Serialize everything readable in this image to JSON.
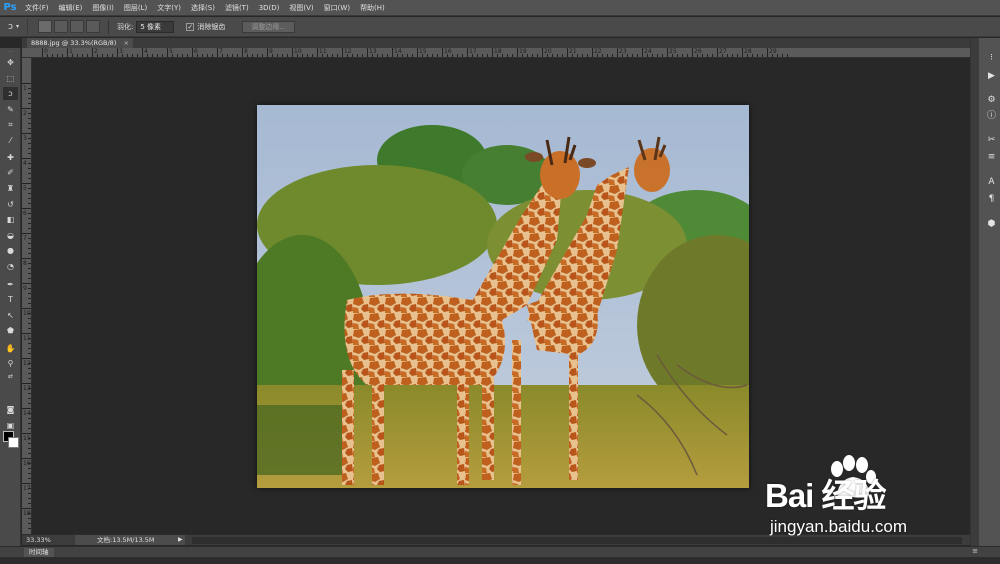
{
  "app": {
    "logo": "Ps"
  },
  "menu": [
    "文件(F)",
    "编辑(E)",
    "图像(I)",
    "图层(L)",
    "文字(Y)",
    "选择(S)",
    "滤镜(T)",
    "3D(D)",
    "视图(V)",
    "窗口(W)",
    "帮助(H)"
  ],
  "options": {
    "tool_icon": "lasso-icon",
    "feather_label": "羽化:",
    "feather_value": "5 像素",
    "antialias_label": "消除锯齿",
    "antialias_checked": true,
    "refine_edge_label": "调整边缘..."
  },
  "document": {
    "tab_title": "8888.jpg @ 33.3%(RGB/8)",
    "close_glyph": "×",
    "image_content": "two-giraffes-photo"
  },
  "ruler_top_labels": [
    "0",
    "1",
    "2",
    "3",
    "4",
    "5",
    "6",
    "7",
    "8",
    "9",
    "10",
    "11",
    "12",
    "13",
    "14",
    "15",
    "16",
    "17",
    "18",
    "19",
    "20",
    "21",
    "22",
    "23",
    "24",
    "25",
    "26",
    "27",
    "28",
    "29"
  ],
  "ruler_left_labels": [
    "1",
    "2",
    "3",
    "4",
    "5",
    "6",
    "7",
    "8",
    "9",
    "10",
    "11",
    "12",
    "13",
    "14",
    "15",
    "16",
    "17",
    "18"
  ],
  "status": {
    "zoom": "33.33%",
    "doc_size": "文档:13.5M/13.5M",
    "arrow_glyph": "▶"
  },
  "timeline": {
    "tab_label": "时间轴",
    "menu_glyph": "≡"
  },
  "watermark": {
    "logo_text": "Bai  经验",
    "url": "jingyan.baidu.com"
  },
  "colors": {
    "foreground": "#000000",
    "background": "#ffffff",
    "sky": "#a9bcd4",
    "grass": "#a8922e",
    "giraffe": "#c2631f"
  }
}
